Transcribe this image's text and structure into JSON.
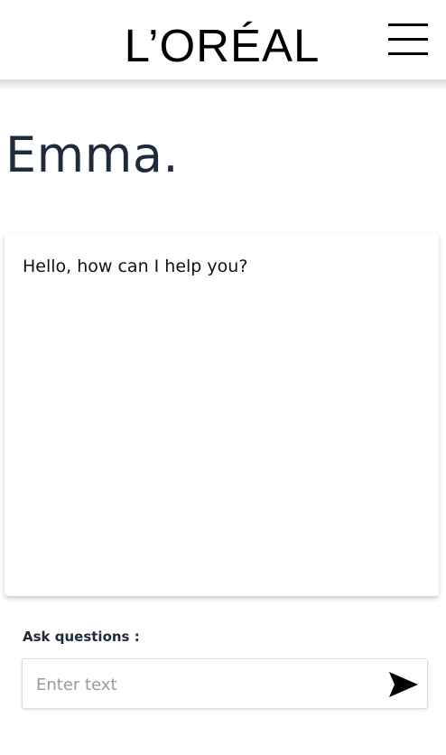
{
  "header": {
    "logo_text": "L’ORÉAL",
    "menu_icon": "hamburger-menu-icon"
  },
  "page": {
    "title": "Emma."
  },
  "chat": {
    "messages": [
      {
        "text": "Hello, how can I help you?"
      }
    ]
  },
  "composer": {
    "label": "Ask questions :",
    "placeholder": "Enter text",
    "value": "",
    "send_icon": "send-arrow-icon"
  }
}
